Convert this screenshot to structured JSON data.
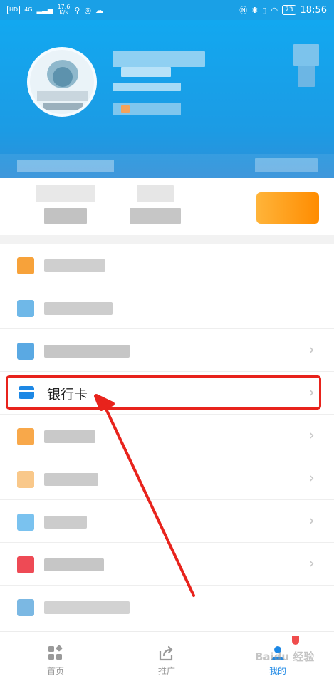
{
  "status_bar": {
    "left_items": [
      "HD",
      "4G",
      "17.6",
      "K/s"
    ],
    "battery": "73",
    "time": "18:56"
  },
  "list": {
    "highlighted_item": {
      "label": "银行卡",
      "icon": "bank-card-icon"
    }
  },
  "bottom_nav": {
    "tabs": [
      {
        "label": "首页",
        "icon": "home-grid-icon"
      },
      {
        "label": "推广",
        "icon": "share-icon"
      },
      {
        "label": "我的",
        "icon": "profile-icon"
      }
    ]
  },
  "watermark": "Baidu 经验",
  "colors": {
    "accent": "#1aa0e6",
    "card_icon": "#1d88e5",
    "annotation": "#e8231c",
    "orange": "#ff8c00"
  }
}
